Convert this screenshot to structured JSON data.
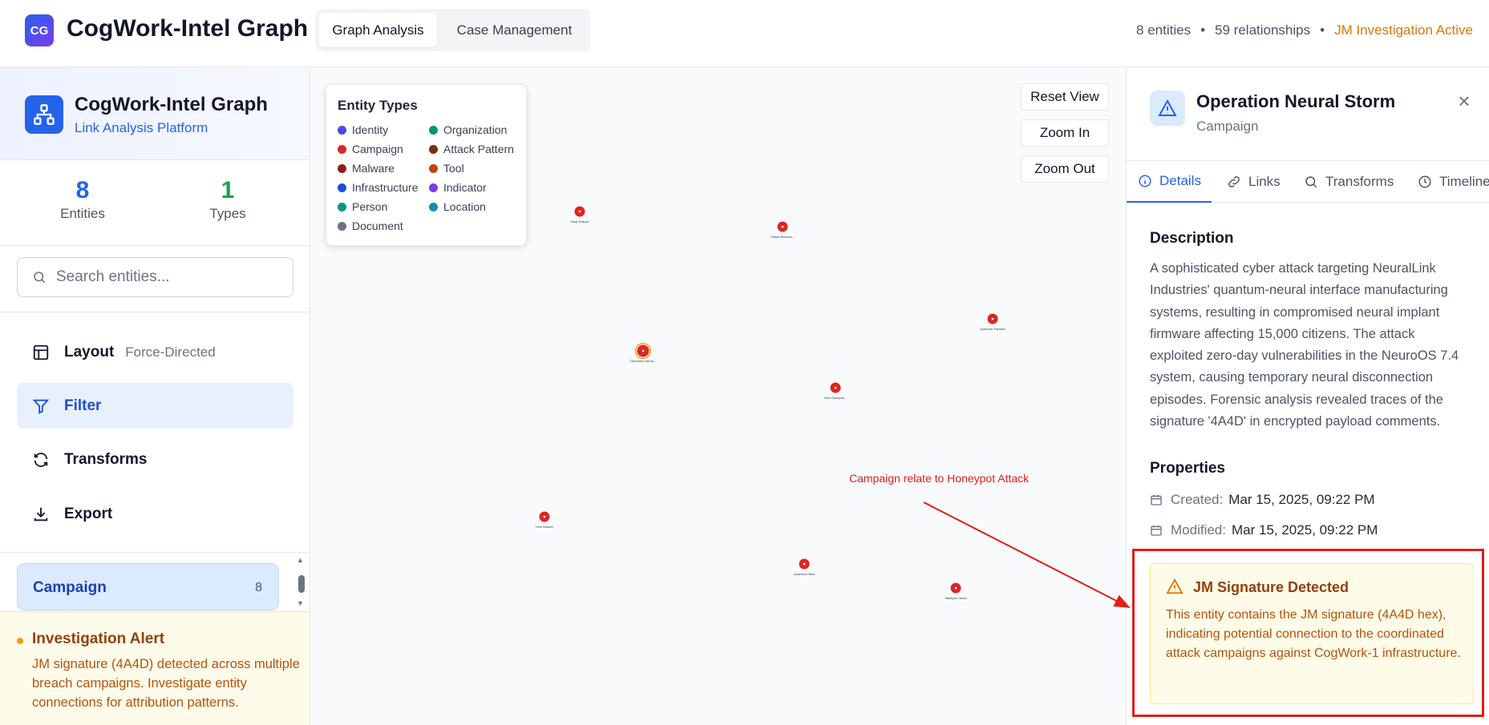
{
  "topbar": {
    "logo_initials": "CG",
    "app_title": "CogWork-Intel Graph",
    "tabs": [
      {
        "label": "Graph Analysis",
        "active": true
      },
      {
        "label": "Case Management",
        "active": false
      }
    ],
    "entity_count_text": "8 entities",
    "relationship_count_text": "59 relationships",
    "separator": "•",
    "investigation_status": "JM Investigation Active"
  },
  "sidebar": {
    "title": "CogWork-Intel Graph",
    "subtitle": "Link Analysis Platform",
    "stats": [
      {
        "value": "8",
        "label": "Entities",
        "color": "#2563eb"
      },
      {
        "value": "1",
        "label": "Types",
        "color": "#16a34a"
      }
    ],
    "search_placeholder": "Search entities...",
    "menu": [
      {
        "label": "Layout",
        "sub": "Force-Directed",
        "icon": "layout-icon",
        "active": false
      },
      {
        "label": "Filter",
        "sub": "",
        "icon": "filter-icon",
        "active": true
      },
      {
        "label": "Transforms",
        "sub": "",
        "icon": "refresh-icon",
        "active": false
      },
      {
        "label": "Export",
        "sub": "",
        "icon": "download-icon",
        "active": false
      }
    ],
    "type_filter": {
      "label": "Campaign",
      "count": "8"
    },
    "alert": {
      "title": "Investigation Alert",
      "text": "JM signature (4A4D) detected across multiple breach campaigns. Investigate entity connections for attribution patterns."
    }
  },
  "canvas": {
    "legend": {
      "title": "Entity Types",
      "items": [
        {
          "label": "Identity",
          "color": "#4f46e5"
        },
        {
          "label": "Organization",
          "color": "#059669"
        },
        {
          "label": "Campaign",
          "color": "#dc2626"
        },
        {
          "label": "Attack Pattern",
          "color": "#7c2d12"
        },
        {
          "label": "Malware",
          "color": "#991b1b"
        },
        {
          "label": "Tool",
          "color": "#c2410c"
        },
        {
          "label": "Infrastructure",
          "color": "#1d4ed8"
        },
        {
          "label": "Indicator",
          "color": "#7c3aed"
        },
        {
          "label": "Person",
          "color": "#0d9488"
        },
        {
          "label": "Location",
          "color": "#0891b2"
        },
        {
          "label": "Document",
          "color": "#6b7280"
        }
      ]
    },
    "controls": {
      "reset": "Reset View",
      "zoom_in": "Zoom In",
      "zoom_out": "Zoom Out"
    },
    "annotation": "Campaign relate to Honeypot Attack",
    "node_color": "#dc2626",
    "nodes": [
      {
        "label": "Solar Eclipse",
        "selected": false
      },
      {
        "label": "Orbital Blackou...",
        "selected": false
      },
      {
        "label": "Quantum Paradox",
        "selected": false
      },
      {
        "label": "Operation Neura...",
        "selected": true
      },
      {
        "label": "Zero Disruptio...",
        "selected": false
      },
      {
        "label": "Hive Breach",
        "selected": false
      },
      {
        "label": "Quantum Heist",
        "selected": false
      },
      {
        "label": "Starlight Chaos",
        "selected": false
      }
    ]
  },
  "detail": {
    "title": "Operation Neural Storm",
    "type": "Campaign",
    "tabs": [
      "Details",
      "Links",
      "Transforms",
      "Timeline"
    ],
    "description_heading": "Description",
    "description": "A sophisticated cyber attack targeting NeuralLink Industries' quantum-neural interface manufacturing systems, resulting in compromised neural implant firmware affecting 15,000 citizens. The attack exploited zero-day vulnerabilities in the NeuroOS 7.4 system, causing temporary neural disconnection episodes. Forensic analysis revealed traces of the signature '4A4D' in encrypted payload comments.",
    "properties_heading": "Properties",
    "created_label": "Created:",
    "created_value": "Mar 15, 2025, 09:22 PM",
    "modified_label": "Modified:",
    "modified_value": "Mar 15, 2025, 09:22 PM",
    "signature": {
      "title": "JM Signature Detected",
      "text": "This entity contains the JM signature (4A4D hex), indicating potential connection to the coordinated attack campaigns against CogWork-1 infrastructure."
    }
  }
}
